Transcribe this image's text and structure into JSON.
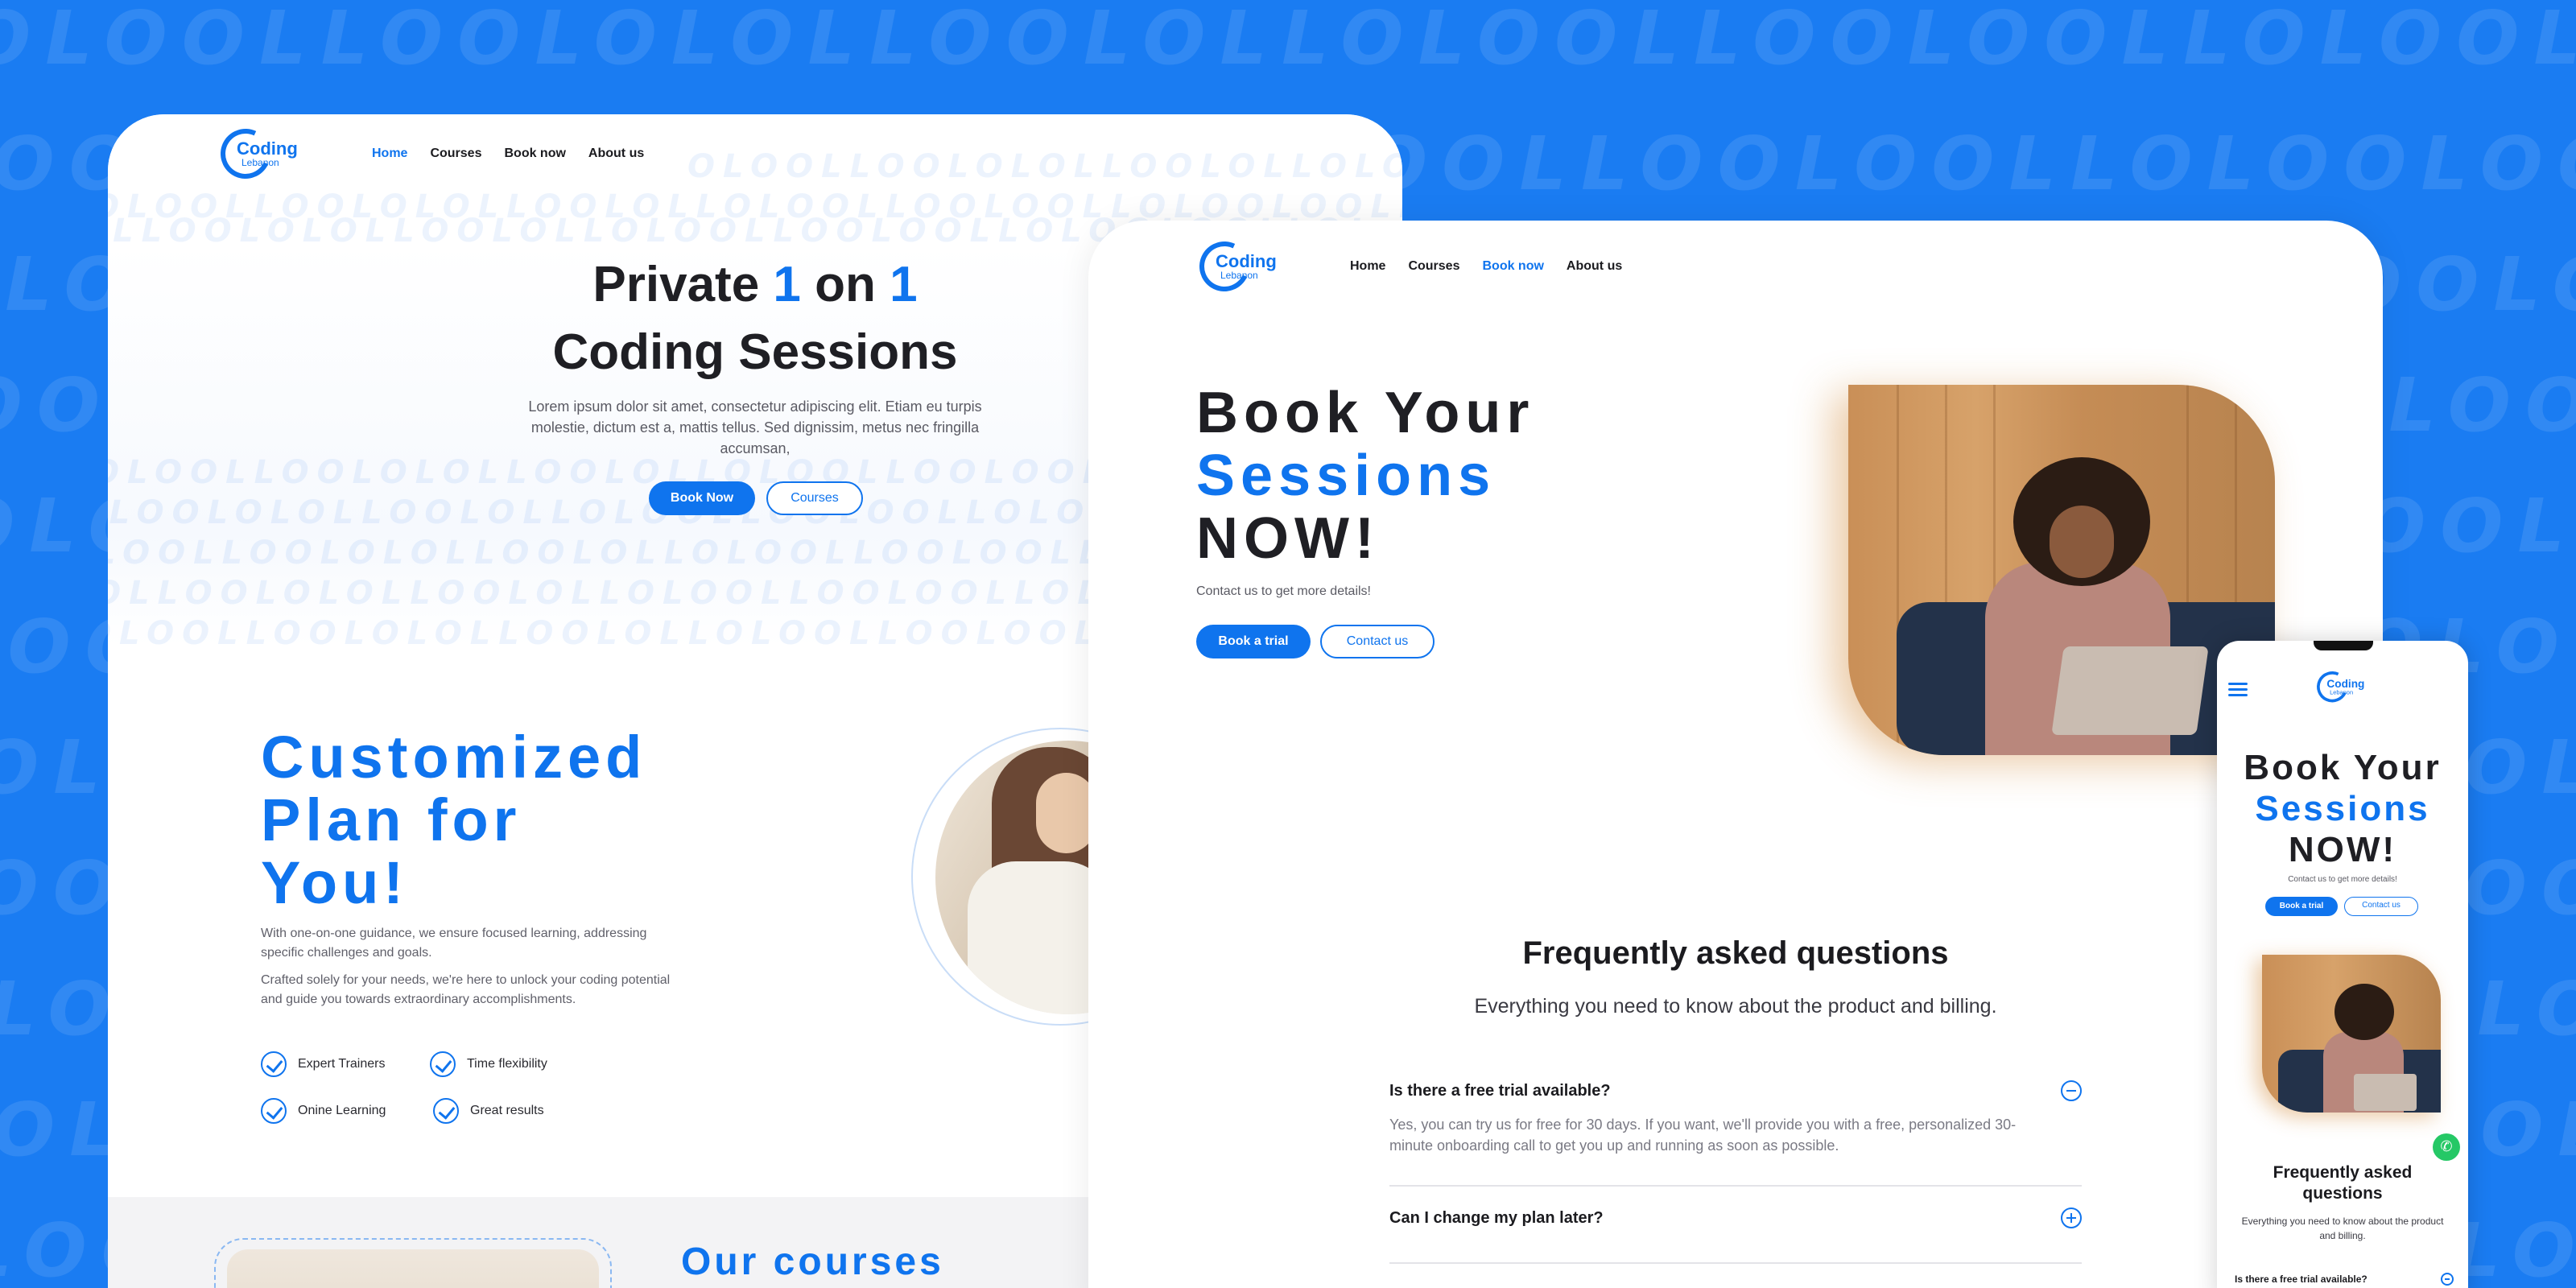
{
  "background": {
    "color": "#1a7cf2",
    "pattern_text": "OLOOLLOOLOLOLLOOLOLLOLOOLLOOLOOLLOLOOLOOLLOL"
  },
  "brand": {
    "logo_word": "Coding",
    "logo_sub": "Lebanon",
    "accent": "#0f74ee"
  },
  "home_page": {
    "nav": [
      "Home",
      "Courses",
      "Book now",
      "About us"
    ],
    "hero": {
      "line1_a": "Private ",
      "line1_b": "1",
      "line1_c": " on ",
      "line1_d": "1",
      "line2": "Coding Sessions",
      "lorem": "Lorem ipsum dolor sit amet, consectetur adipiscing elit. Etiam eu turpis molestie, dictum est a, mattis tellus. Sed dignissim, metus nec fringilla accumsan,",
      "btn_book": "Book Now",
      "btn_courses": "Courses"
    },
    "custom": {
      "title_l1": "Customized",
      "title_l2": "Plan for",
      "title_l3": "You!",
      "para1": "With one-on-one guidance, we ensure focused learning, addressing specific challenges and goals.",
      "para2": "Crafted solely for your needs, we're here to unlock your coding potential and guide you towards extraordinary accomplishments.",
      "features": [
        "Expert Trainers",
        "Time flexibility",
        "Onine Learning",
        "Great results"
      ]
    },
    "courses_title": "Our courses"
  },
  "book_page": {
    "nav": [
      "Home",
      "Courses",
      "Book now",
      "About us"
    ],
    "title_l1": "Book Your",
    "title_l2": "Sessions",
    "title_l3": "NOW!",
    "contact_text": "Contact us to get more details!",
    "btn_trial": "Book a trial",
    "btn_contact": "Contact us",
    "faq": {
      "title": "Frequently asked questions",
      "subtitle": "Everything you need to know about the product and billing.",
      "items": [
        {
          "q": "Is there a free trial available?",
          "a": "Yes, you can try us for free for 30 days. If you want, we'll provide you with a free, personalized 30-minute onboarding call to get you up and running as soon as possible.",
          "open": true
        },
        {
          "q": "Can I change my plan later?",
          "a": "",
          "open": false
        }
      ]
    }
  },
  "mobile_page": {
    "title_l1": "Book Your",
    "title_l2": "Sessions",
    "title_l3": "NOW!",
    "contact_text": "Contact us to get more details!",
    "btn_trial": "Book a trial",
    "btn_contact": "Contact us",
    "faq_title": "Frequently asked questions",
    "faq_subtitle": "Everything you need to know about the product and billing.",
    "faq_q1": "Is there a free trial available?",
    "whatsapp_icon": "whatsapp-icon"
  }
}
